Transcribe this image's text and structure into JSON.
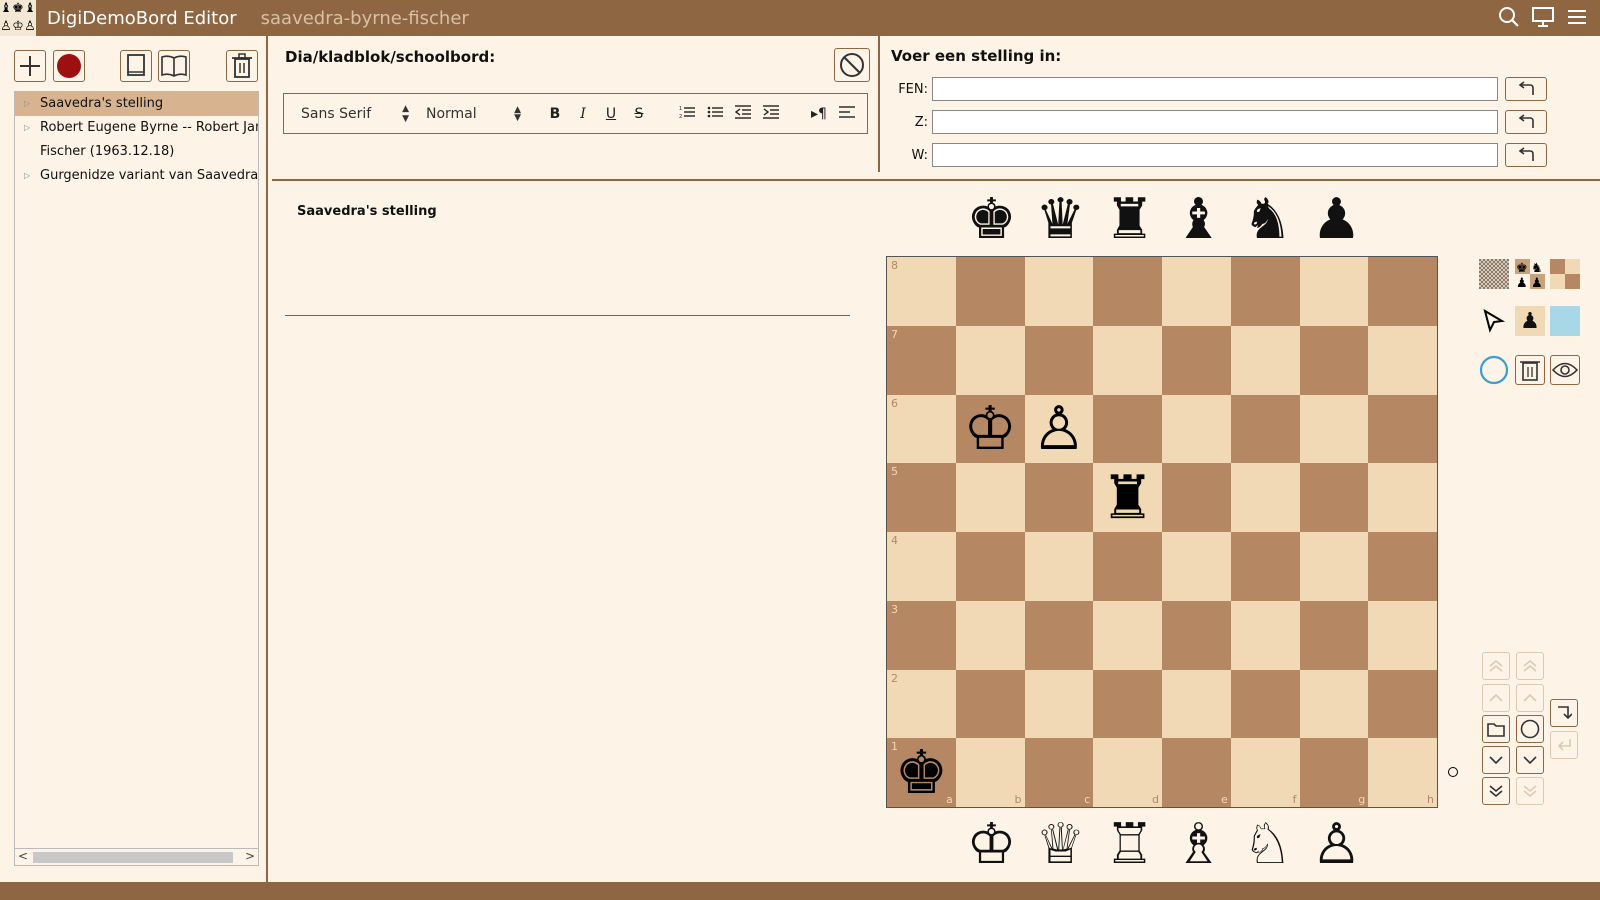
{
  "app": {
    "title": "DigiDemoBord Editor",
    "document": "saavedra-byrne-fischer"
  },
  "tree": {
    "items": [
      {
        "label": "Saavedra's stelling",
        "selected": true
      },
      {
        "label": "Robert Eugene Byrne -- Robert James",
        "continuation": "Fischer (1963.12.18)"
      },
      {
        "label": "Gurgenidze variant van Saavedra"
      }
    ]
  },
  "editor": {
    "header": "Dia/kladblok/schoolbord:",
    "font": "Sans Serif",
    "size": "Normal",
    "note_title": "Saavedra's stelling"
  },
  "position": {
    "header": "Voer een stelling in:",
    "fen_label": "FEN:",
    "z_label": "Z:",
    "w_label": "W:",
    "fen_value": "",
    "z_value": "",
    "w_value": ""
  },
  "board": {
    "files": [
      "a",
      "b",
      "c",
      "d",
      "e",
      "f",
      "g",
      "h"
    ],
    "ranks": [
      "8",
      "7",
      "6",
      "5",
      "4",
      "3",
      "2",
      "1"
    ],
    "pieces": {
      "b6": "♔",
      "c6": "♙",
      "d5": "♜",
      "a1": "♚"
    }
  },
  "palette": {
    "black": [
      "♚",
      "♛",
      "♜",
      "♝",
      "♞",
      "♟"
    ],
    "white": [
      "♔",
      "♕",
      "♖",
      "♗",
      "♘",
      "♙"
    ]
  },
  "colors": {
    "accent": "#8e6642",
    "light_square": "#f1d9b5",
    "dark_square": "#b58863",
    "background": "#fdf3e6",
    "selection": "#d7b48f",
    "record": "#9e0f0f",
    "fill_blue": "#a8d8e8"
  }
}
